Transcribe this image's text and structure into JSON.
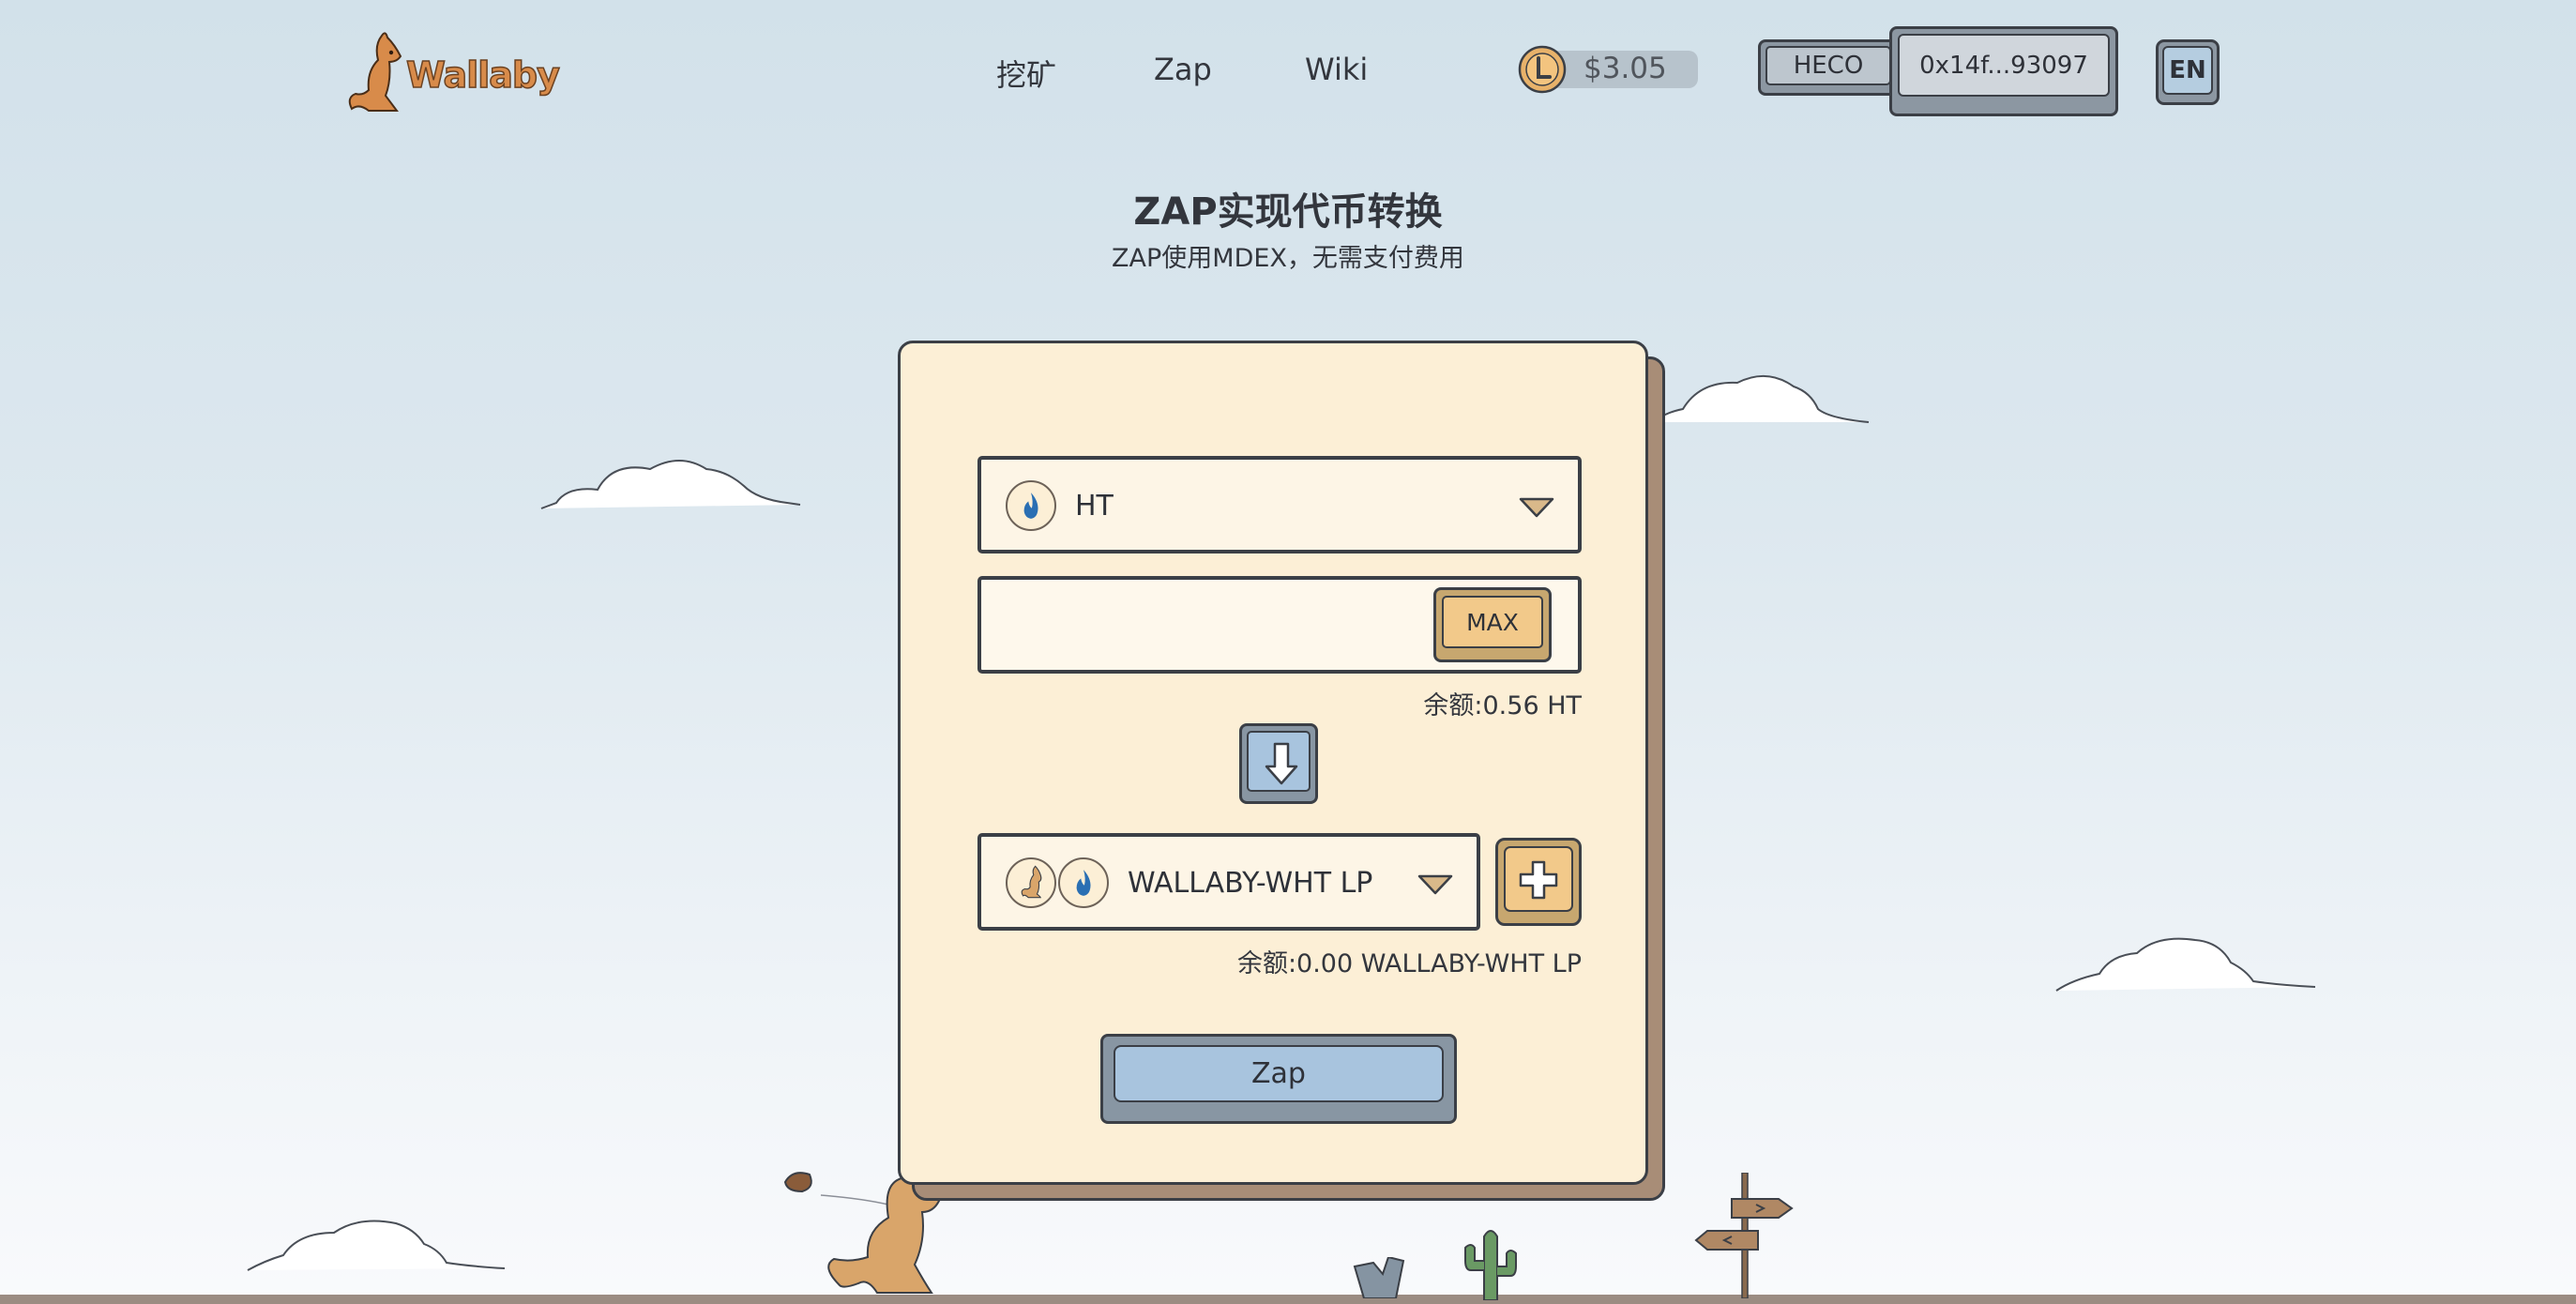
{
  "header": {
    "logo_text": "Wallaby",
    "nav": [
      {
        "label": "挖矿"
      },
      {
        "label": "Zap"
      },
      {
        "label": "Wiki"
      }
    ],
    "price": "$3.05",
    "network_label": "HECO",
    "wallet_address": "0x14f...93097",
    "language_label": "EN"
  },
  "main": {
    "title": "ZAP实现代币转换",
    "subtitle": "ZAP使用MDEX，无需支付费用"
  },
  "zap_form": {
    "from_token": "HT",
    "amount_value": "",
    "max_label": "MAX",
    "from_balance": "余额:0.56 HT",
    "to_token": "WALLABY-WHT LP",
    "to_balance": "余额:0.00 WALLABY-WHT LP",
    "submit_label": "Zap"
  },
  "colors": {
    "card": "#fcefd6",
    "card_shadow": "#a88d77",
    "button_blue": "#a8c4de",
    "button_gold": "#f2c98a",
    "outline": "#3b3f46",
    "ground": "#9b8c82"
  },
  "icons": [
    "kangaroo-logo-icon",
    "wallaby-coin-icon",
    "ht-token-icon",
    "wallaby-token-icon",
    "chevron-down-icon",
    "arrow-down-icon",
    "plus-icon"
  ]
}
